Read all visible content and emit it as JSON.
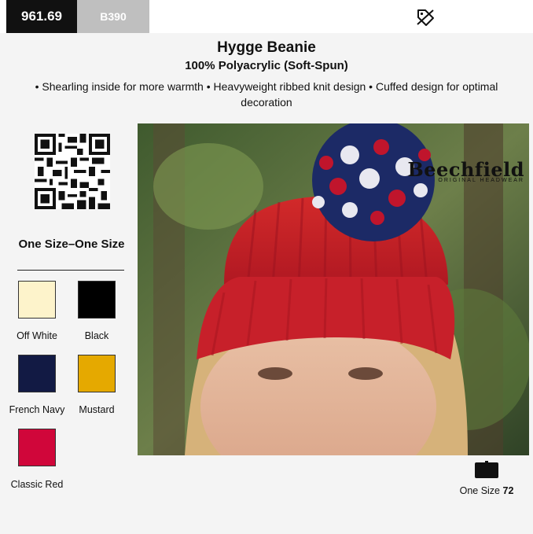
{
  "header": {
    "price": "961.69",
    "sku": "B390",
    "tag_icon": "tag-discount-icon"
  },
  "product": {
    "title": "Hygge Beanie",
    "material": "100% Polyacrylic (Soft-Spun)",
    "features": "• Shearling inside for more warmth • Heavyweight ribbed knit design • Cuffed design for optimal decoration",
    "brand_logo": {
      "name": "Beechfield",
      "tagline": "ORIGINAL HEADWEAR"
    }
  },
  "sizes": {
    "heading": "One Size–One Size"
  },
  "colors": [
    {
      "name": "Off White",
      "hex": "#fdf3cb"
    },
    {
      "name": "Black",
      "hex": "#000000"
    },
    {
      "name": "French Navy",
      "hex": "#121a44"
    },
    {
      "name": "Mustard",
      "hex": "#e5a900"
    },
    {
      "name": "Classic Red",
      "hex": "#d0063a"
    }
  ],
  "size_stock": {
    "label": "One Size",
    "count": "72",
    "icon": "stock-box-icon"
  }
}
